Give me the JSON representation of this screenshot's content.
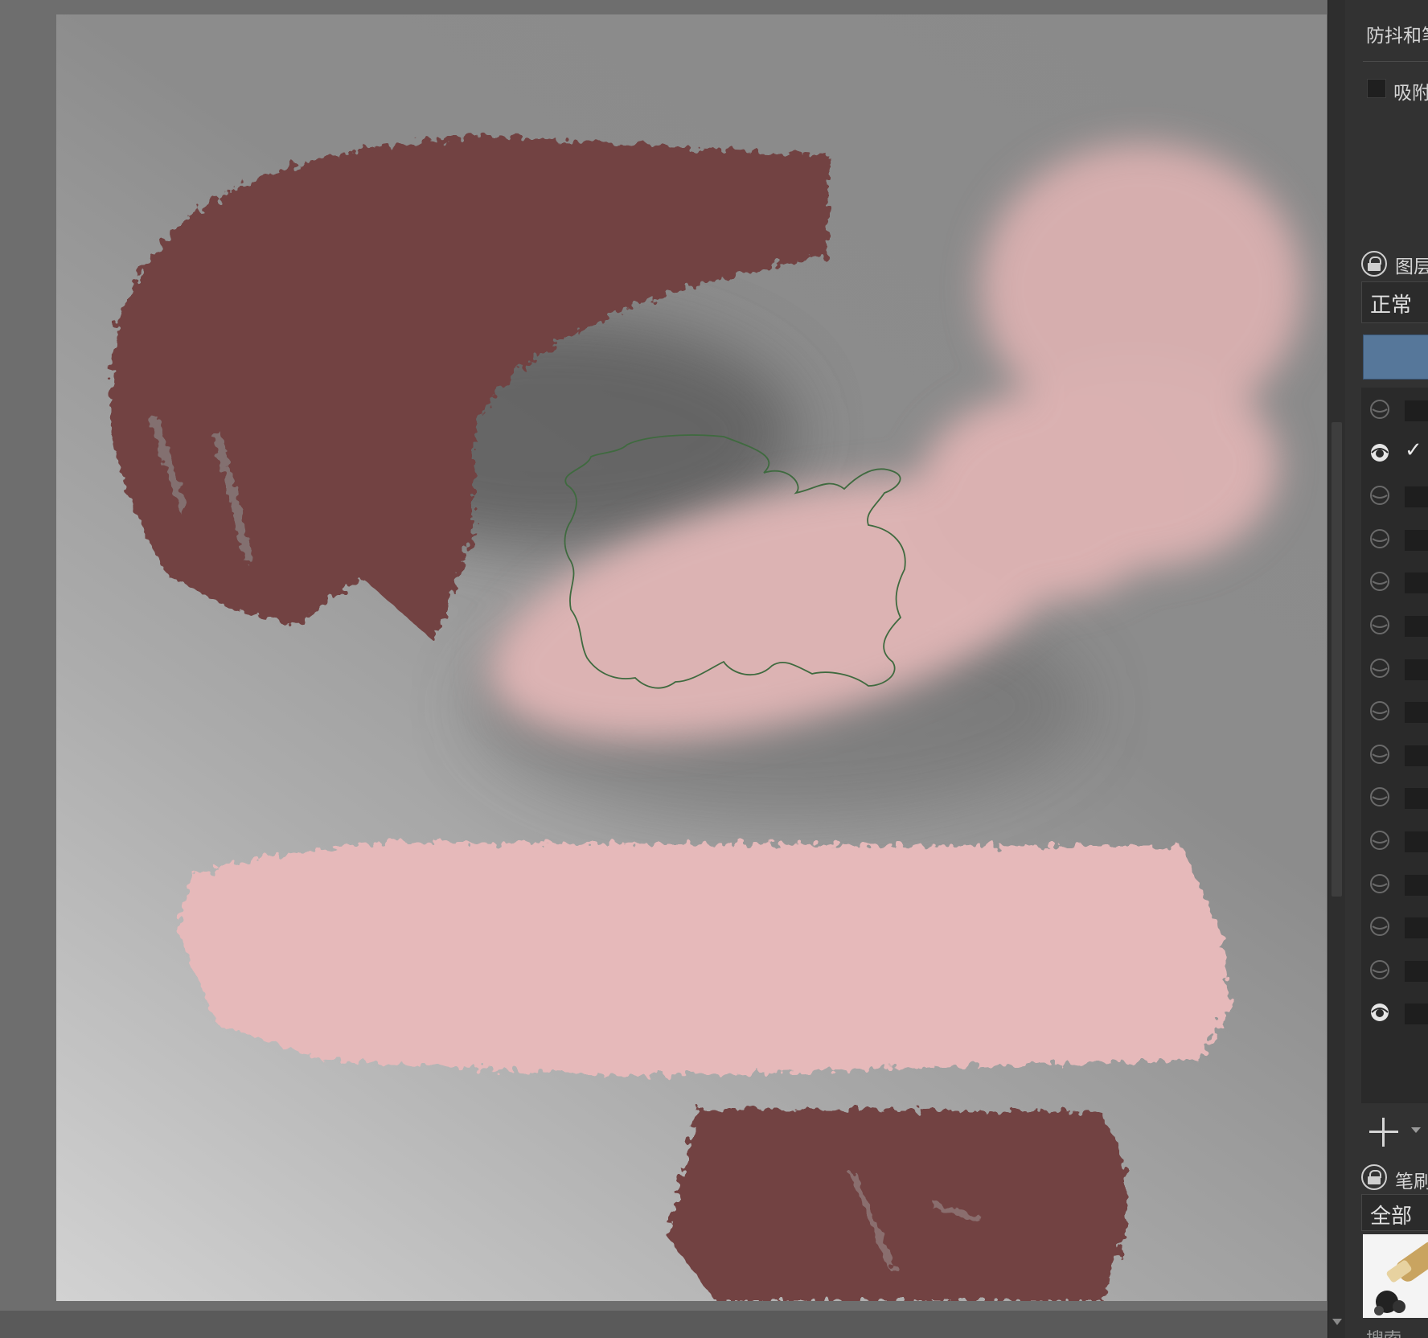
{
  "panel": {
    "stabilizer_title": "防抖和笔",
    "snap_label": "吸附",
    "layers_title": "图层",
    "blend_mode": "正常",
    "brushes_title": "笔刷",
    "brush_filter": "全部",
    "search_label": "搜索"
  },
  "layers": [
    {
      "visible": false,
      "checked": false
    },
    {
      "visible": true,
      "checked": true
    },
    {
      "visible": false,
      "checked": false
    },
    {
      "visible": false,
      "checked": false
    },
    {
      "visible": false,
      "checked": false
    },
    {
      "visible": false,
      "checked": false
    },
    {
      "visible": false,
      "checked": false
    },
    {
      "visible": false,
      "checked": false
    },
    {
      "visible": false,
      "checked": false
    },
    {
      "visible": false,
      "checked": false
    },
    {
      "visible": false,
      "checked": false
    },
    {
      "visible": false,
      "checked": false
    },
    {
      "visible": false,
      "checked": false
    },
    {
      "visible": false,
      "checked": false
    },
    {
      "visible": true,
      "checked": false
    }
  ],
  "colors": {
    "dark_stroke": "#724343",
    "light_stroke": "#e6b9ba",
    "blurred_stroke": "#dcb2b2",
    "selection_outline": "#3f6a3f",
    "active_layer": "#56779a"
  },
  "layer_check_mark": "✓"
}
